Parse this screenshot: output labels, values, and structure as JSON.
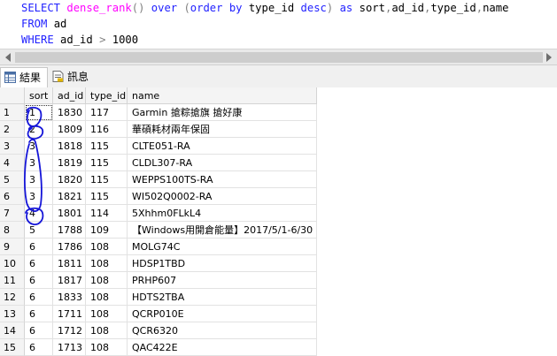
{
  "editor": {
    "lines": [
      [
        {
          "t": "SELECT ",
          "c": "kw"
        },
        {
          "t": "dense_rank",
          "c": "fn"
        },
        {
          "t": "() ",
          "c": "op"
        },
        {
          "t": "over ",
          "c": "kw"
        },
        {
          "t": "(",
          "c": "op"
        },
        {
          "t": "order by ",
          "c": "kw"
        },
        {
          "t": "type_id ",
          "c": "txt"
        },
        {
          "t": "desc",
          "c": "kw"
        },
        {
          "t": ") ",
          "c": "op"
        },
        {
          "t": "as ",
          "c": "kw"
        },
        {
          "t": "sort",
          "c": "txt"
        },
        {
          "t": ",",
          "c": "op"
        },
        {
          "t": "ad_id",
          "c": "txt"
        },
        {
          "t": ",",
          "c": "op"
        },
        {
          "t": "type_id",
          "c": "txt"
        },
        {
          "t": ",",
          "c": "op"
        },
        {
          "t": "name",
          "c": "txt"
        }
      ],
      [
        {
          "t": "FROM ",
          "c": "kw"
        },
        {
          "t": "ad",
          "c": "txt"
        }
      ],
      [
        {
          "t": "WHERE ",
          "c": "kw"
        },
        {
          "t": "ad_id ",
          "c": "txt"
        },
        {
          "t": "> ",
          "c": "op"
        },
        {
          "t": "1000",
          "c": "txt"
        }
      ]
    ]
  },
  "tabs": {
    "results": "結果",
    "messages": "訊息"
  },
  "colors": {
    "keyword": "#1f1fff",
    "function": "#ff00ff",
    "operator": "#808080",
    "annotation": "#1515d8"
  },
  "grid": {
    "columns": [
      "sort",
      "ad_id",
      "type_id",
      "name"
    ],
    "rows": [
      [
        "1",
        "1",
        "1830",
        "117",
        "Garmin 搶粽搶旗 搶好康"
      ],
      [
        "2",
        "2",
        "1809",
        "116",
        "華碩耗材兩年保固"
      ],
      [
        "3",
        "3",
        "1818",
        "115",
        "CLTE051-RA"
      ],
      [
        "4",
        "3",
        "1819",
        "115",
        "CLDL307-RA"
      ],
      [
        "5",
        "3",
        "1820",
        "115",
        "WEPPS100TS-RA"
      ],
      [
        "6",
        "3",
        "1821",
        "115",
        "WI502Q0002-RA"
      ],
      [
        "7",
        "4",
        "1801",
        "114",
        "5Xhhm0FLkL4"
      ],
      [
        "8",
        "5",
        "1788",
        "109",
        "【Windows用開倉能量】2017/5/1-6/30"
      ],
      [
        "9",
        "6",
        "1786",
        "108",
        "MOLG74C"
      ],
      [
        "10",
        "6",
        "1811",
        "108",
        "HDSP1TBD"
      ],
      [
        "11",
        "6",
        "1817",
        "108",
        "PRHP607"
      ],
      [
        "12",
        "6",
        "1833",
        "108",
        "HDTS2TBA"
      ],
      [
        "13",
        "6",
        "1711",
        "108",
        "QCRP010E"
      ],
      [
        "14",
        "6",
        "1712",
        "108",
        "QCR6320"
      ],
      [
        "15",
        "6",
        "1713",
        "108",
        "QAC422E"
      ]
    ]
  }
}
